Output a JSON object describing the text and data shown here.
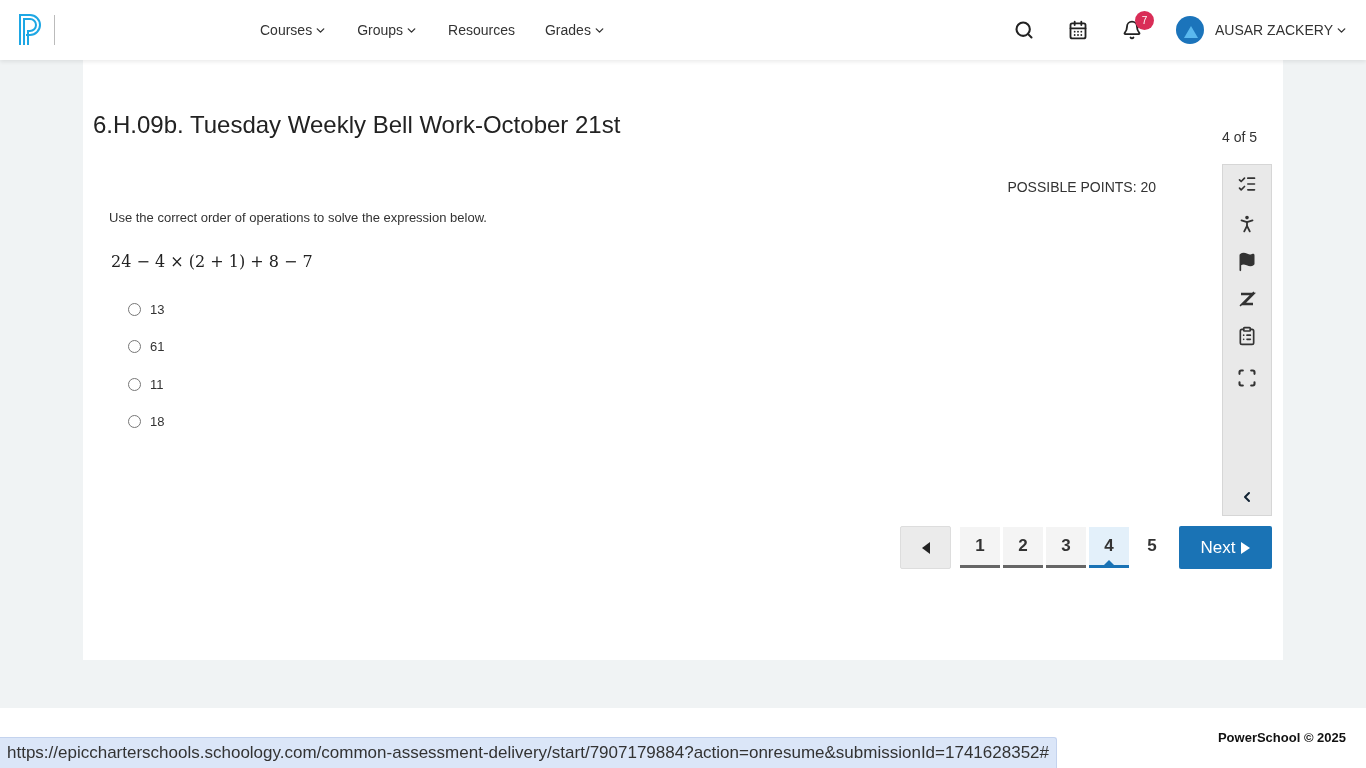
{
  "nav": {
    "items": [
      {
        "label": "Courses",
        "dropdown": true
      },
      {
        "label": "Groups",
        "dropdown": true
      },
      {
        "label": "Resources",
        "dropdown": false
      },
      {
        "label": "Grades",
        "dropdown": true
      }
    ],
    "notification_count": "7",
    "user": "AUSAR ZACKERY"
  },
  "assessment": {
    "title": "6.H.09b. Tuesday Weekly Bell Work-October 21st",
    "progress": "4 of 5",
    "points": "POSSIBLE POINTS: 20",
    "prompt": "Use the correct order of operations to solve the expression below.",
    "expression": "24 − 4 × (2 + 1) + 8 − 7",
    "options": [
      {
        "label": "13",
        "selected": false
      },
      {
        "label": "61",
        "selected": false
      },
      {
        "label": "11",
        "selected": false
      },
      {
        "label": "18",
        "selected": false
      }
    ]
  },
  "pagination": {
    "pages": [
      {
        "label": "1",
        "answered": true,
        "selected": false
      },
      {
        "label": "2",
        "answered": true,
        "selected": false
      },
      {
        "label": "3",
        "answered": true,
        "selected": false
      },
      {
        "label": "4",
        "answered": false,
        "selected": true
      },
      {
        "label": "5",
        "answered": false,
        "selected": false
      }
    ],
    "next": "Next"
  },
  "footer": {
    "copyright": "PowerSchool © 2025"
  },
  "status_url": "https://epiccharterschools.schoology.com/common-assessment-delivery/start/7907179884?action=onresume&submissionId=1741628352#"
}
